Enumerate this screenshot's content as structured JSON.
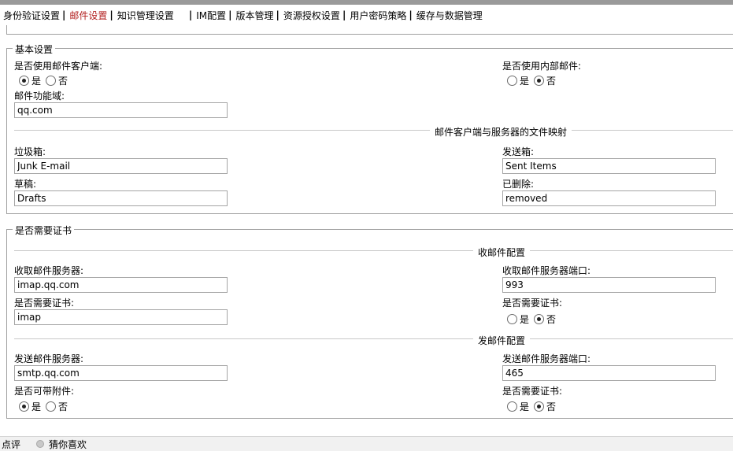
{
  "tabs": [
    {
      "label": "身份验证设置"
    },
    {
      "label": "邮件设置"
    },
    {
      "label": "知识管理设置"
    },
    {
      "label": "IM配置"
    },
    {
      "label": "版本管理"
    },
    {
      "label": "资源授权设置"
    },
    {
      "label": "用户密码策略"
    },
    {
      "label": "缓存与数据管理"
    }
  ],
  "basic": {
    "legend": "基本设置",
    "use_client": {
      "label": "是否使用邮件客户端:",
      "yes": "是",
      "no": "否",
      "selected": "yes"
    },
    "use_internal": {
      "label": "是否使用内部邮件:",
      "yes": "是",
      "no": "否",
      "selected": "no"
    },
    "domain": {
      "label": "邮件功能域:",
      "value": "qq.com"
    },
    "mapping_title": "邮件客户端与服务器的文件映射",
    "junk": {
      "label": "垃圾箱:",
      "value": "Junk E-mail"
    },
    "sent": {
      "label": "发送箱:",
      "value": "Sent Items"
    },
    "drafts": {
      "label": "草稿:",
      "value": "Drafts"
    },
    "deleted": {
      "label": "已删除:",
      "value": "removed"
    }
  },
  "cert": {
    "legend": "是否需要证书",
    "recv_title": "收邮件配置",
    "recv_server": {
      "label": "收取邮件服务器:",
      "value": "imap.qq.com"
    },
    "recv_port": {
      "label": "收取邮件服务器端口:",
      "value": "993"
    },
    "recv_cert": {
      "label": "是否需要证书:",
      "value": "imap"
    },
    "recv_cert_radio": {
      "label": "是否需要证书:",
      "yes": "是",
      "no": "否",
      "selected": "no"
    },
    "send_title": "发邮件配置",
    "send_server": {
      "label": "发送邮件服务器:",
      "value": "smtp.qq.com"
    },
    "send_port": {
      "label": "发送邮件服务器端口:",
      "value": "465"
    },
    "attach": {
      "label": "是否可带附件:",
      "yes": "是",
      "no": "否",
      "selected": "yes"
    },
    "send_cert_radio": {
      "label": "是否需要证书:",
      "yes": "是",
      "no": "否",
      "selected": "no"
    }
  },
  "bottom": {
    "comment": "点评",
    "guess": "猜你喜欢"
  }
}
